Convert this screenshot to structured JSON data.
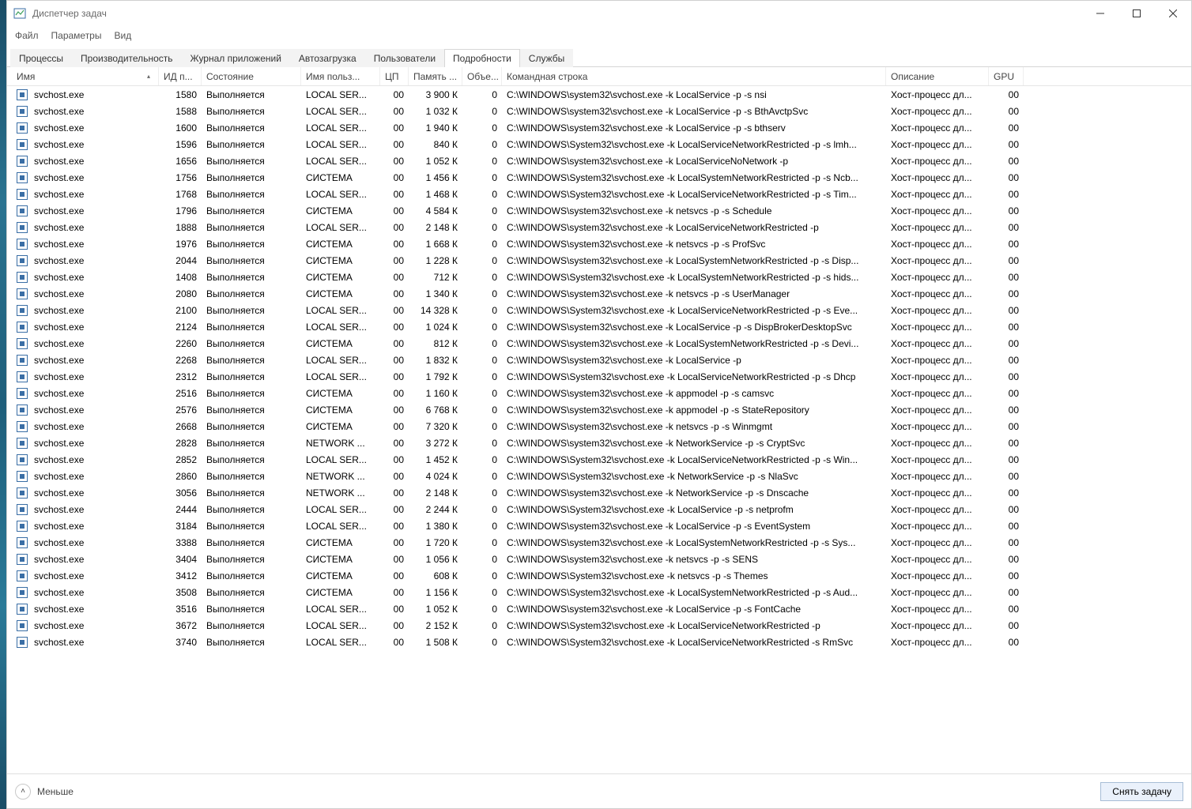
{
  "window": {
    "title": "Диспетчер задач"
  },
  "menu": {
    "file": "Файл",
    "options": "Параметры",
    "view": "Вид"
  },
  "tabs": {
    "processes": "Процессы",
    "performance": "Производительность",
    "app_history": "Журнал приложений",
    "startup": "Автозагрузка",
    "users": "Пользователи",
    "details": "Подробности",
    "services": "Службы",
    "active": "details"
  },
  "columns": {
    "name": "Имя",
    "pid": "ИД п...",
    "status": "Состояние",
    "user": "Имя польз...",
    "cpu": "ЦП",
    "memory": "Память ...",
    "objects": "Объе...",
    "cmdline": "Командная строка",
    "description": "Описание",
    "gpu": "GPU"
  },
  "footer": {
    "fewer": "Меньше",
    "end_task": "Снять задачу"
  },
  "rows": [
    {
      "name": "svchost.exe",
      "pid": "1580",
      "status": "Выполняется",
      "user": "LOCAL SER...",
      "cpu": "00",
      "mem": "3 900 К",
      "obj": "0",
      "cmd": "C:\\WINDOWS\\system32\\svchost.exe -k LocalService -p -s nsi",
      "desc": "Хост-процесс дл...",
      "gpu": "00"
    },
    {
      "name": "svchost.exe",
      "pid": "1588",
      "status": "Выполняется",
      "user": "LOCAL SER...",
      "cpu": "00",
      "mem": "1 032 К",
      "obj": "0",
      "cmd": "C:\\WINDOWS\\system32\\svchost.exe -k LocalService -p -s BthAvctpSvc",
      "desc": "Хост-процесс дл...",
      "gpu": "00"
    },
    {
      "name": "svchost.exe",
      "pid": "1600",
      "status": "Выполняется",
      "user": "LOCAL SER...",
      "cpu": "00",
      "mem": "1 940 К",
      "obj": "0",
      "cmd": "C:\\WINDOWS\\system32\\svchost.exe -k LocalService -p -s bthserv",
      "desc": "Хост-процесс дл...",
      "gpu": "00"
    },
    {
      "name": "svchost.exe",
      "pid": "1596",
      "status": "Выполняется",
      "user": "LOCAL SER...",
      "cpu": "00",
      "mem": "840 К",
      "obj": "0",
      "cmd": "C:\\WINDOWS\\System32\\svchost.exe -k LocalServiceNetworkRestricted -p -s lmh...",
      "desc": "Хост-процесс дл...",
      "gpu": "00"
    },
    {
      "name": "svchost.exe",
      "pid": "1656",
      "status": "Выполняется",
      "user": "LOCAL SER...",
      "cpu": "00",
      "mem": "1 052 К",
      "obj": "0",
      "cmd": "C:\\WINDOWS\\system32\\svchost.exe -k LocalServiceNoNetwork -p",
      "desc": "Хост-процесс дл...",
      "gpu": "00"
    },
    {
      "name": "svchost.exe",
      "pid": "1756",
      "status": "Выполняется",
      "user": "СИСТЕМА",
      "cpu": "00",
      "mem": "1 456 К",
      "obj": "0",
      "cmd": "C:\\WINDOWS\\System32\\svchost.exe -k LocalSystemNetworkRestricted -p -s Ncb...",
      "desc": "Хост-процесс дл...",
      "gpu": "00"
    },
    {
      "name": "svchost.exe",
      "pid": "1768",
      "status": "Выполняется",
      "user": "LOCAL SER...",
      "cpu": "00",
      "mem": "1 468 К",
      "obj": "0",
      "cmd": "C:\\WINDOWS\\System32\\svchost.exe -k LocalServiceNetworkRestricted -p -s Tim...",
      "desc": "Хост-процесс дл...",
      "gpu": "00"
    },
    {
      "name": "svchost.exe",
      "pid": "1796",
      "status": "Выполняется",
      "user": "СИСТЕМА",
      "cpu": "00",
      "mem": "4 584 К",
      "obj": "0",
      "cmd": "C:\\WINDOWS\\system32\\svchost.exe -k netsvcs -p -s Schedule",
      "desc": "Хост-процесс дл...",
      "gpu": "00"
    },
    {
      "name": "svchost.exe",
      "pid": "1888",
      "status": "Выполняется",
      "user": "LOCAL SER...",
      "cpu": "00",
      "mem": "2 148 К",
      "obj": "0",
      "cmd": "C:\\WINDOWS\\system32\\svchost.exe -k LocalServiceNetworkRestricted -p",
      "desc": "Хост-процесс дл...",
      "gpu": "00"
    },
    {
      "name": "svchost.exe",
      "pid": "1976",
      "status": "Выполняется",
      "user": "СИСТЕМА",
      "cpu": "00",
      "mem": "1 668 К",
      "obj": "0",
      "cmd": "C:\\WINDOWS\\system32\\svchost.exe -k netsvcs -p -s ProfSvc",
      "desc": "Хост-процесс дл...",
      "gpu": "00"
    },
    {
      "name": "svchost.exe",
      "pid": "2044",
      "status": "Выполняется",
      "user": "СИСТЕМА",
      "cpu": "00",
      "mem": "1 228 К",
      "obj": "0",
      "cmd": "C:\\WINDOWS\\system32\\svchost.exe -k LocalSystemNetworkRestricted -p -s Disp...",
      "desc": "Хост-процесс дл...",
      "gpu": "00"
    },
    {
      "name": "svchost.exe",
      "pid": "1408",
      "status": "Выполняется",
      "user": "СИСТЕМА",
      "cpu": "00",
      "mem": "712 К",
      "obj": "0",
      "cmd": "C:\\WINDOWS\\System32\\svchost.exe -k LocalSystemNetworkRestricted -p -s hids...",
      "desc": "Хост-процесс дл...",
      "gpu": "00"
    },
    {
      "name": "svchost.exe",
      "pid": "2080",
      "status": "Выполняется",
      "user": "СИСТЕМА",
      "cpu": "00",
      "mem": "1 340 К",
      "obj": "0",
      "cmd": "C:\\WINDOWS\\system32\\svchost.exe -k netsvcs -p -s UserManager",
      "desc": "Хост-процесс дл...",
      "gpu": "00"
    },
    {
      "name": "svchost.exe",
      "pid": "2100",
      "status": "Выполняется",
      "user": "LOCAL SER...",
      "cpu": "00",
      "mem": "14 328 К",
      "obj": "0",
      "cmd": "C:\\WINDOWS\\System32\\svchost.exe -k LocalServiceNetworkRestricted -p -s Eve...",
      "desc": "Хост-процесс дл...",
      "gpu": "00"
    },
    {
      "name": "svchost.exe",
      "pid": "2124",
      "status": "Выполняется",
      "user": "LOCAL SER...",
      "cpu": "00",
      "mem": "1 024 К",
      "obj": "0",
      "cmd": "C:\\WINDOWS\\system32\\svchost.exe -k LocalService -p -s DispBrokerDesktopSvc",
      "desc": "Хост-процесс дл...",
      "gpu": "00"
    },
    {
      "name": "svchost.exe",
      "pid": "2260",
      "status": "Выполняется",
      "user": "СИСТЕМА",
      "cpu": "00",
      "mem": "812 К",
      "obj": "0",
      "cmd": "C:\\WINDOWS\\system32\\svchost.exe -k LocalSystemNetworkRestricted -p -s Devi...",
      "desc": "Хост-процесс дл...",
      "gpu": "00"
    },
    {
      "name": "svchost.exe",
      "pid": "2268",
      "status": "Выполняется",
      "user": "LOCAL SER...",
      "cpu": "00",
      "mem": "1 832 К",
      "obj": "0",
      "cmd": "C:\\WINDOWS\\system32\\svchost.exe -k LocalService -p",
      "desc": "Хост-процесс дл...",
      "gpu": "00"
    },
    {
      "name": "svchost.exe",
      "pid": "2312",
      "status": "Выполняется",
      "user": "LOCAL SER...",
      "cpu": "00",
      "mem": "1 792 К",
      "obj": "0",
      "cmd": "C:\\WINDOWS\\System32\\svchost.exe -k LocalServiceNetworkRestricted -p -s Dhcp",
      "desc": "Хост-процесс дл...",
      "gpu": "00"
    },
    {
      "name": "svchost.exe",
      "pid": "2516",
      "status": "Выполняется",
      "user": "СИСТЕМА",
      "cpu": "00",
      "mem": "1 160 К",
      "obj": "0",
      "cmd": "C:\\WINDOWS\\system32\\svchost.exe -k appmodel -p -s camsvc",
      "desc": "Хост-процесс дл...",
      "gpu": "00"
    },
    {
      "name": "svchost.exe",
      "pid": "2576",
      "status": "Выполняется",
      "user": "СИСТЕМА",
      "cpu": "00",
      "mem": "6 768 К",
      "obj": "0",
      "cmd": "C:\\WINDOWS\\system32\\svchost.exe -k appmodel -p -s StateRepository",
      "desc": "Хост-процесс дл...",
      "gpu": "00"
    },
    {
      "name": "svchost.exe",
      "pid": "2668",
      "status": "Выполняется",
      "user": "СИСТЕМА",
      "cpu": "00",
      "mem": "7 320 К",
      "obj": "0",
      "cmd": "C:\\WINDOWS\\system32\\svchost.exe -k netsvcs -p -s Winmgmt",
      "desc": "Хост-процесс дл...",
      "gpu": "00"
    },
    {
      "name": "svchost.exe",
      "pid": "2828",
      "status": "Выполняется",
      "user": "NETWORK ...",
      "cpu": "00",
      "mem": "3 272 К",
      "obj": "0",
      "cmd": "C:\\WINDOWS\\system32\\svchost.exe -k NetworkService -p -s CryptSvc",
      "desc": "Хост-процесс дл...",
      "gpu": "00"
    },
    {
      "name": "svchost.exe",
      "pid": "2852",
      "status": "Выполняется",
      "user": "LOCAL SER...",
      "cpu": "00",
      "mem": "1 452 К",
      "obj": "0",
      "cmd": "C:\\WINDOWS\\System32\\svchost.exe -k LocalServiceNetworkRestricted -p -s Win...",
      "desc": "Хост-процесс дл...",
      "gpu": "00"
    },
    {
      "name": "svchost.exe",
      "pid": "2860",
      "status": "Выполняется",
      "user": "NETWORK ...",
      "cpu": "00",
      "mem": "4 024 К",
      "obj": "0",
      "cmd": "C:\\WINDOWS\\System32\\svchost.exe -k NetworkService -p -s NlaSvc",
      "desc": "Хост-процесс дл...",
      "gpu": "00"
    },
    {
      "name": "svchost.exe",
      "pid": "3056",
      "status": "Выполняется",
      "user": "NETWORK ...",
      "cpu": "00",
      "mem": "2 148 К",
      "obj": "0",
      "cmd": "C:\\WINDOWS\\system32\\svchost.exe -k NetworkService -p -s Dnscache",
      "desc": "Хост-процесс дл...",
      "gpu": "00"
    },
    {
      "name": "svchost.exe",
      "pid": "2444",
      "status": "Выполняется",
      "user": "LOCAL SER...",
      "cpu": "00",
      "mem": "2 244 К",
      "obj": "0",
      "cmd": "C:\\WINDOWS\\System32\\svchost.exe -k LocalService -p -s netprofm",
      "desc": "Хост-процесс дл...",
      "gpu": "00"
    },
    {
      "name": "svchost.exe",
      "pid": "3184",
      "status": "Выполняется",
      "user": "LOCAL SER...",
      "cpu": "00",
      "mem": "1 380 К",
      "obj": "0",
      "cmd": "C:\\WINDOWS\\system32\\svchost.exe -k LocalService -p -s EventSystem",
      "desc": "Хост-процесс дл...",
      "gpu": "00"
    },
    {
      "name": "svchost.exe",
      "pid": "3388",
      "status": "Выполняется",
      "user": "СИСТЕМА",
      "cpu": "00",
      "mem": "1 720 К",
      "obj": "0",
      "cmd": "C:\\WINDOWS\\system32\\svchost.exe -k LocalSystemNetworkRestricted -p -s Sys...",
      "desc": "Хост-процесс дл...",
      "gpu": "00"
    },
    {
      "name": "svchost.exe",
      "pid": "3404",
      "status": "Выполняется",
      "user": "СИСТЕМА",
      "cpu": "00",
      "mem": "1 056 К",
      "obj": "0",
      "cmd": "C:\\WINDOWS\\system32\\svchost.exe -k netsvcs -p -s SENS",
      "desc": "Хост-процесс дл...",
      "gpu": "00"
    },
    {
      "name": "svchost.exe",
      "pid": "3412",
      "status": "Выполняется",
      "user": "СИСТЕМА",
      "cpu": "00",
      "mem": "608 К",
      "obj": "0",
      "cmd": "C:\\WINDOWS\\System32\\svchost.exe -k netsvcs -p -s Themes",
      "desc": "Хост-процесс дл...",
      "gpu": "00"
    },
    {
      "name": "svchost.exe",
      "pid": "3508",
      "status": "Выполняется",
      "user": "СИСТЕМА",
      "cpu": "00",
      "mem": "1 156 К",
      "obj": "0",
      "cmd": "C:\\WINDOWS\\System32\\svchost.exe -k LocalSystemNetworkRestricted -p -s Aud...",
      "desc": "Хост-процесс дл...",
      "gpu": "00"
    },
    {
      "name": "svchost.exe",
      "pid": "3516",
      "status": "Выполняется",
      "user": "LOCAL SER...",
      "cpu": "00",
      "mem": "1 052 К",
      "obj": "0",
      "cmd": "C:\\WINDOWS\\system32\\svchost.exe -k LocalService -p -s FontCache",
      "desc": "Хост-процесс дл...",
      "gpu": "00"
    },
    {
      "name": "svchost.exe",
      "pid": "3672",
      "status": "Выполняется",
      "user": "LOCAL SER...",
      "cpu": "00",
      "mem": "2 152 К",
      "obj": "0",
      "cmd": "C:\\WINDOWS\\System32\\svchost.exe -k LocalServiceNetworkRestricted -p",
      "desc": "Хост-процесс дл...",
      "gpu": "00"
    },
    {
      "name": "svchost.exe",
      "pid": "3740",
      "status": "Выполняется",
      "user": "LOCAL SER...",
      "cpu": "00",
      "mem": "1 508 К",
      "obj": "0",
      "cmd": "C:\\WINDOWS\\System32\\svchost.exe -k LocalServiceNetworkRestricted -s RmSvc",
      "desc": "Хост-процесс дл...",
      "gpu": "00"
    }
  ]
}
